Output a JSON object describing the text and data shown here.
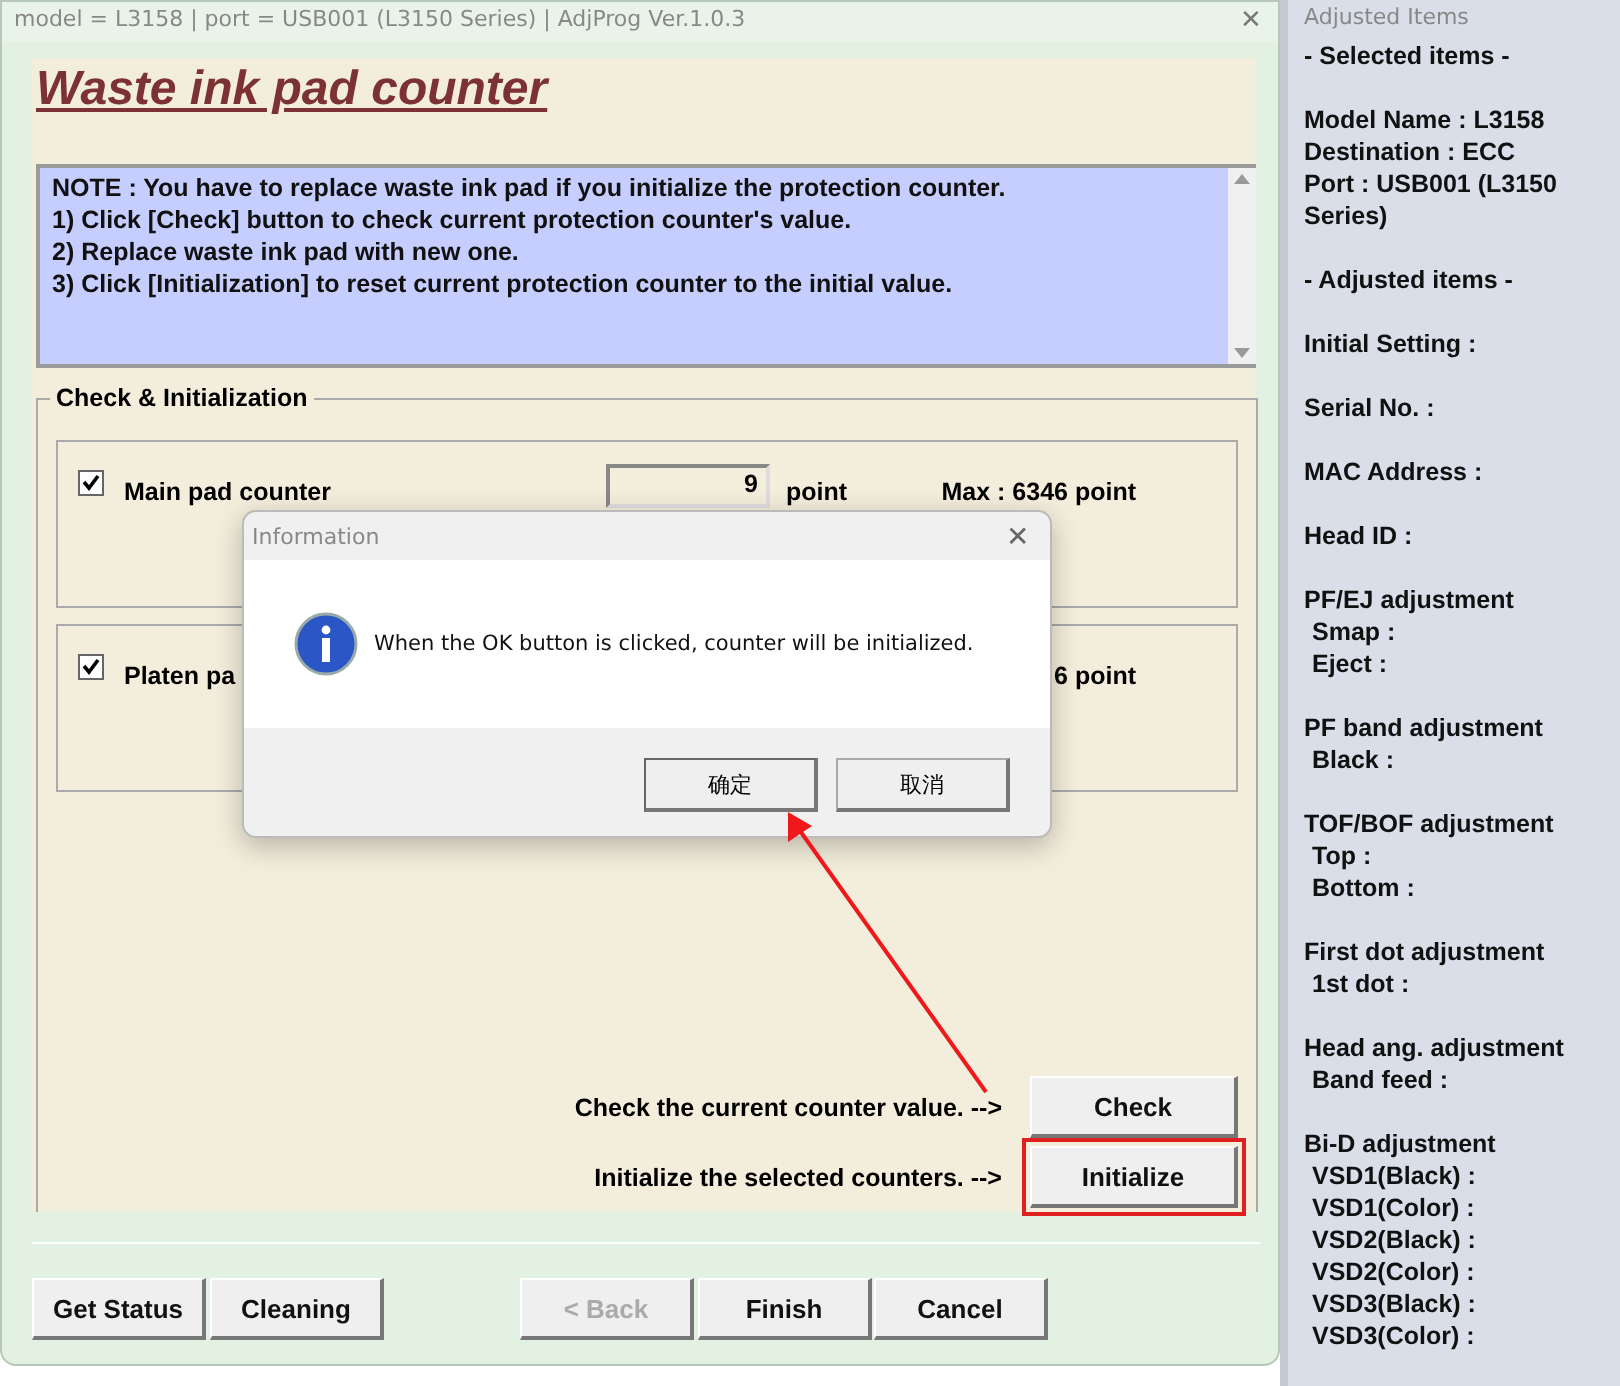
{
  "window": {
    "title": "model = L3158 | port = USB001 (L3150 Series) | AdjProg Ver.1.0.3",
    "close": "✕"
  },
  "heading": "Waste ink pad counter",
  "note": [
    "NOTE : You have to replace waste ink pad if you initialize the protection counter.",
    "1) Click [Check] button to check current protection counter's value.",
    "2) Replace waste ink pad with new one.",
    "3) Click [Initialization] to reset current protection counter to the initial value."
  ],
  "group": {
    "title": "Check & Initialization",
    "counters": [
      {
        "label": "Main pad counter",
        "checked": true,
        "value": "9",
        "unit": "point",
        "max": "Max : 6346 point"
      },
      {
        "label": "Platen pa",
        "checked": true,
        "max": "6 point"
      }
    ],
    "actions": [
      {
        "label": "Check the current counter value. -->",
        "button": "Check",
        "highlighted": false
      },
      {
        "label": "Initialize the selected counters. -->",
        "button": "Initialize",
        "highlighted": true
      }
    ]
  },
  "footer": [
    {
      "label": "Get Status",
      "disabled": false
    },
    {
      "label": "Cleaning",
      "disabled": false
    },
    {
      "label": "< Back",
      "disabled": true
    },
    {
      "label": "Finish",
      "disabled": false
    },
    {
      "label": "Cancel",
      "disabled": false
    }
  ],
  "side": {
    "title": "Adjusted Items",
    "blocks": [
      [
        {
          "text": "- Selected items -"
        }
      ],
      [
        {
          "text": "Model Name : L3158"
        },
        {
          "text": "Destination : ECC"
        },
        {
          "text": "Port : USB001 (L3150 Series)"
        }
      ],
      [
        {
          "text": "- Adjusted items -"
        }
      ],
      [
        {
          "text": "Initial Setting :"
        }
      ],
      [
        {
          "text": "Serial No. :"
        }
      ],
      [
        {
          "text": "MAC Address :"
        }
      ],
      [
        {
          "text": "Head ID :"
        }
      ],
      [
        {
          "text": "PF/EJ adjustment",
          "children": [
            "Smap :",
            "Eject :"
          ]
        }
      ],
      [
        {
          "text": "PF band adjustment",
          "children": [
            "Black :"
          ]
        }
      ],
      [
        {
          "text": "TOF/BOF adjustment",
          "children": [
            "Top :",
            "Bottom :"
          ]
        }
      ],
      [
        {
          "text": "First dot adjustment",
          "children": [
            "1st dot :"
          ]
        }
      ],
      [
        {
          "text": "Head ang. adjustment",
          "children": [
            "Band feed :"
          ]
        }
      ],
      [
        {
          "text": "Bi-D adjustment",
          "children": [
            "VSD1(Black) :",
            "VSD1(Color) :",
            "VSD2(Black) :",
            "VSD2(Color) :",
            "VSD3(Black) :",
            "VSD3(Color) :"
          ]
        }
      ]
    ]
  },
  "dialog": {
    "title": "Information",
    "close": "✕",
    "message": "When the OK button is clicked, counter will be initialized.",
    "buttons": [
      {
        "label": "确定",
        "focused": true
      },
      {
        "label": "取消",
        "focused": false
      }
    ]
  }
}
